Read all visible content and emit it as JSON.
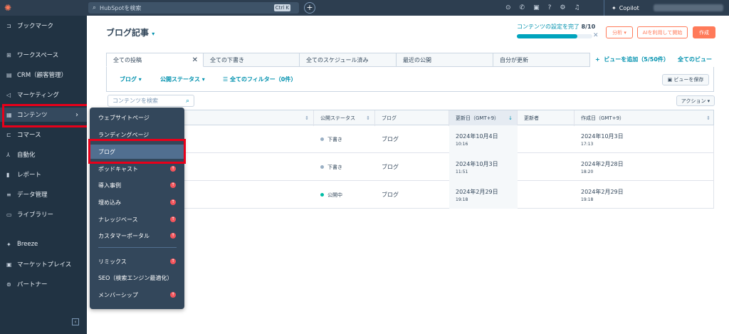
{
  "topbar": {
    "logo": "HubSpot",
    "search_placeholder": "HubSpotを検索",
    "search_shortcut": "Ctrl K",
    "copilot_label": "Copilot"
  },
  "sidebar": {
    "items": [
      {
        "label": "ブックマーク",
        "icon": "bookmark-icon"
      },
      {
        "label": "ワークスペース",
        "icon": "workspace-icon"
      },
      {
        "label": "CRM（顧客管理）",
        "icon": "crm-icon"
      },
      {
        "label": "マーケティング",
        "icon": "marketing-icon"
      },
      {
        "label": "コンテンツ",
        "icon": "content-icon"
      },
      {
        "label": "コマース",
        "icon": "commerce-icon"
      },
      {
        "label": "自動化",
        "icon": "automation-icon"
      },
      {
        "label": "レポート",
        "icon": "report-icon"
      },
      {
        "label": "データ管理",
        "icon": "data-icon"
      },
      {
        "label": "ライブラリー",
        "icon": "library-icon"
      },
      {
        "label": "Breeze",
        "icon": "breeze-icon"
      },
      {
        "label": "マーケットプレイス",
        "icon": "marketplace-icon"
      },
      {
        "label": "パートナー",
        "icon": "partner-icon"
      }
    ]
  },
  "content_menu": {
    "items": [
      {
        "label": "ウェブサイトページ",
        "upgrade": false
      },
      {
        "label": "ランディングページ",
        "upgrade": false
      },
      {
        "label": "ブログ",
        "upgrade": false
      },
      {
        "label": "ポッドキャスト",
        "upgrade": true
      },
      {
        "label": "導入事例",
        "upgrade": true
      },
      {
        "label": "埋め込み",
        "upgrade": true
      },
      {
        "label": "ナレッジベース",
        "upgrade": true
      },
      {
        "label": "カスタマーポータル",
        "upgrade": true
      },
      {
        "label": "リミックス",
        "upgrade": true
      },
      {
        "label": "SEO（検索エンジン最適化）",
        "upgrade": false
      },
      {
        "label": "メンバーシップ",
        "upgrade": true
      }
    ]
  },
  "header": {
    "title": "ブログ記事",
    "setup_text": "コンテンツの設定を完了",
    "setup_count": "8/10",
    "setup_progress": 0.8,
    "analyze_label": "分析",
    "ai_label": "AIを利用して開始",
    "create_label": "作成"
  },
  "tabs": [
    {
      "label": "全ての投稿"
    },
    {
      "label": "全ての下書き"
    },
    {
      "label": "全てのスケジュール済み"
    },
    {
      "label": "最近の公開"
    },
    {
      "label": "自分が更新"
    }
  ],
  "add_view_label": "ビューを追加（5/50件）",
  "all_views_label": "全てのビュー",
  "filters": {
    "blog": "ブログ",
    "status": "公開ステータス",
    "all_filters": "全てのフィルター（0件）",
    "save_view": "ビューを保存"
  },
  "table_search_placeholder": "コンテンツを検索",
  "actions_label": "アクション",
  "table": {
    "columns": [
      "公開ステータス",
      "ブログ",
      "更新日（GMT+9）",
      "更新者",
      "作成日（GMT+9）"
    ],
    "rows": [
      {
        "status": "下書き",
        "status_color": "#99afc4",
        "blog": "ブログ",
        "updated_date": "2024年10月4日",
        "updated_time": "10:16",
        "created_date": "2024年10月3日",
        "created_time": "17:13"
      },
      {
        "status": "下書き",
        "status_color": "#99afc4",
        "blog": "ブログ",
        "updated_date": "2024年10月3日",
        "updated_time": "11:51",
        "created_date": "2024年2月28日",
        "created_time": "18:20"
      },
      {
        "status": "公開中",
        "status_color": "#00bda5",
        "blog": "ブログ",
        "updated_date": "2024年2月29日",
        "updated_time": "19:18",
        "created_date": "2024年2月29日",
        "created_time": "19:18"
      }
    ]
  }
}
